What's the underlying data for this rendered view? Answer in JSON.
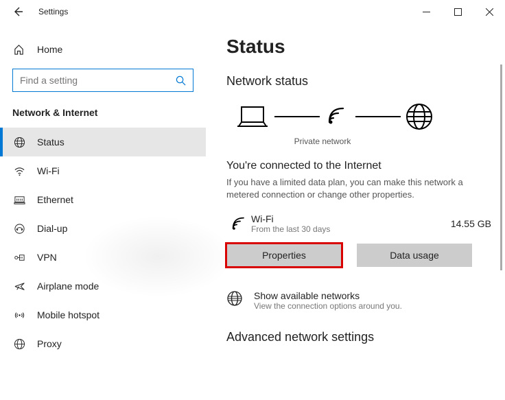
{
  "window": {
    "title": "Settings",
    "home_label": "Home",
    "search_placeholder": "Find a setting",
    "section_label": "Network & Internet"
  },
  "nav": {
    "items": [
      {
        "label": "Status"
      },
      {
        "label": "Wi-Fi"
      },
      {
        "label": "Ethernet"
      },
      {
        "label": "Dial-up"
      },
      {
        "label": "VPN"
      },
      {
        "label": "Airplane mode"
      },
      {
        "label": "Mobile hotspot"
      },
      {
        "label": "Proxy"
      }
    ]
  },
  "main": {
    "page_title": "Status",
    "sub_title": "Network status",
    "network_name": "Private network",
    "connected_title": "You're connected to the Internet",
    "connected_desc": "If you have a limited data plan, you can make this network a metered connection or change other properties.",
    "conn_name": "Wi-Fi",
    "conn_period": "From the last 30 days",
    "data_amount": "14.55 GB",
    "properties_btn": "Properties",
    "usage_btn": "Data usage",
    "avail_title": "Show available networks",
    "avail_desc": "View the connection options around you.",
    "adv_title": "Advanced network settings"
  }
}
